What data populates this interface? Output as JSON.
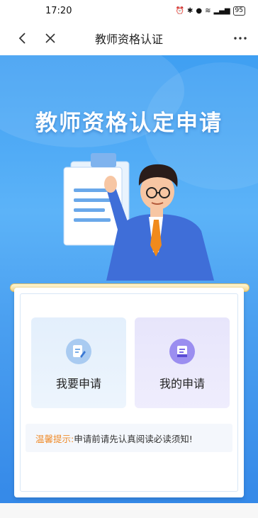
{
  "status_bar": {
    "time": "17:20",
    "battery": "95"
  },
  "nav": {
    "title": "教师资格认证"
  },
  "hero": {
    "title": "教师资格认定申请"
  },
  "actions": [
    {
      "label": "我要申请",
      "icon": "document-edit-icon"
    },
    {
      "label": "我的申请",
      "icon": "inbox-list-icon"
    }
  ],
  "tip": {
    "prefix": "温馨提示:",
    "text": "申请前请先认真阅读必读须知!"
  },
  "colors": {
    "accent": "#3f9ff2",
    "tip_highlight": "#ef8b2a"
  }
}
